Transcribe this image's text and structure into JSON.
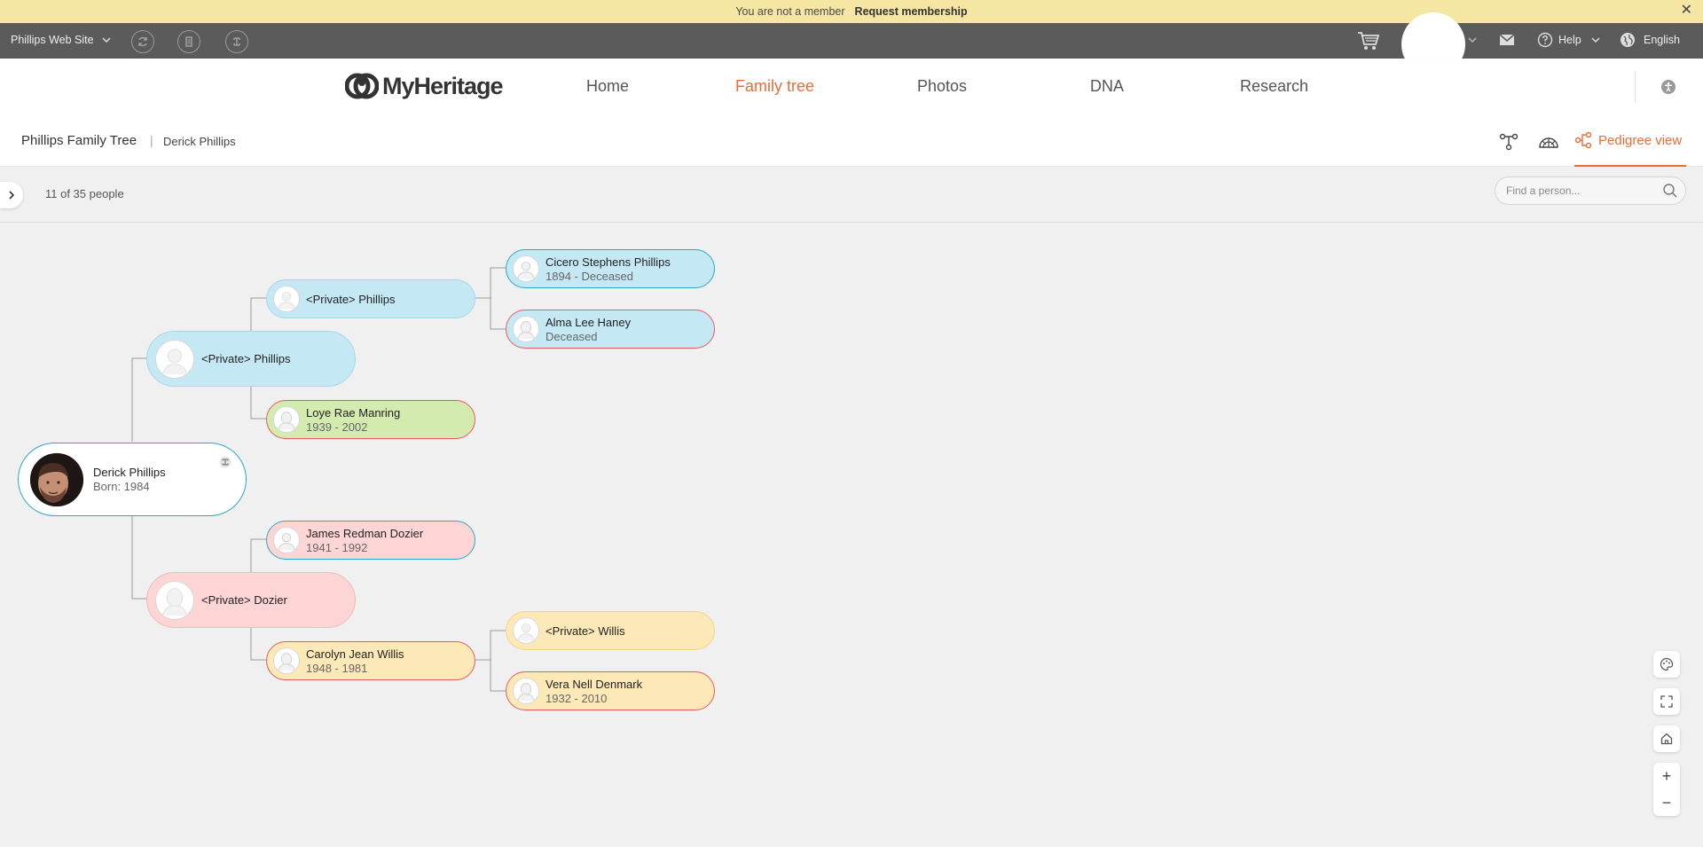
{
  "banner": {
    "message": "You are not a member",
    "request": "Request membership",
    "close": "✕"
  },
  "sitebar": {
    "site_name": "Phillips Web Site",
    "help": "Help",
    "language": "English"
  },
  "nav": {
    "logo": "MyHeritage",
    "items": [
      {
        "label": "Home",
        "active": false
      },
      {
        "label": "Family tree",
        "active": true
      },
      {
        "label": "Photos",
        "active": false
      },
      {
        "label": "DNA",
        "active": false
      },
      {
        "label": "Research",
        "active": false
      }
    ]
  },
  "tree": {
    "name": "Phillips Family Tree",
    "separator": "|",
    "person": "Derick Phillips",
    "view_label": "Pedigree view"
  },
  "filter": {
    "count": "11 of 35 people",
    "search_placeholder": "Find a person..."
  },
  "people": [
    {
      "id": "root",
      "name": "Derick Phillips",
      "life": "Born: 1984"
    },
    {
      "id": "father",
      "name": "<Private> Phillips",
      "life": ""
    },
    {
      "id": "mother",
      "name": "<Private> Dozier",
      "life": ""
    },
    {
      "id": "pgf",
      "name": "<Private> Phillips",
      "life": ""
    },
    {
      "id": "pgm",
      "name": "Loye Rae Manring",
      "life": "1939 - 2002"
    },
    {
      "id": "mgf",
      "name": "James Redman Dozier",
      "life": "1941 - 1992"
    },
    {
      "id": "mgm",
      "name": "Carolyn Jean Willis",
      "life": "1948 - 1981"
    },
    {
      "id": "ggf1",
      "name": "Cicero Stephens Phillips",
      "life": "1894 - Deceased"
    },
    {
      "id": "ggm1",
      "name": "Alma Lee Haney",
      "life": "Deceased"
    },
    {
      "id": "ggf2",
      "name": "<Private> Willis",
      "life": ""
    },
    {
      "id": "ggm2",
      "name": "Vera Nell Denmark",
      "life": "1932 - 2010"
    }
  ],
  "zoom": {
    "plus": "+",
    "minus": "−"
  },
  "colors": {
    "accent": "#e86d3a",
    "male": "#c5e8f5",
    "female": "#fdd5d5",
    "green": "#d4ebb0",
    "yellow": "#fde9b8"
  }
}
